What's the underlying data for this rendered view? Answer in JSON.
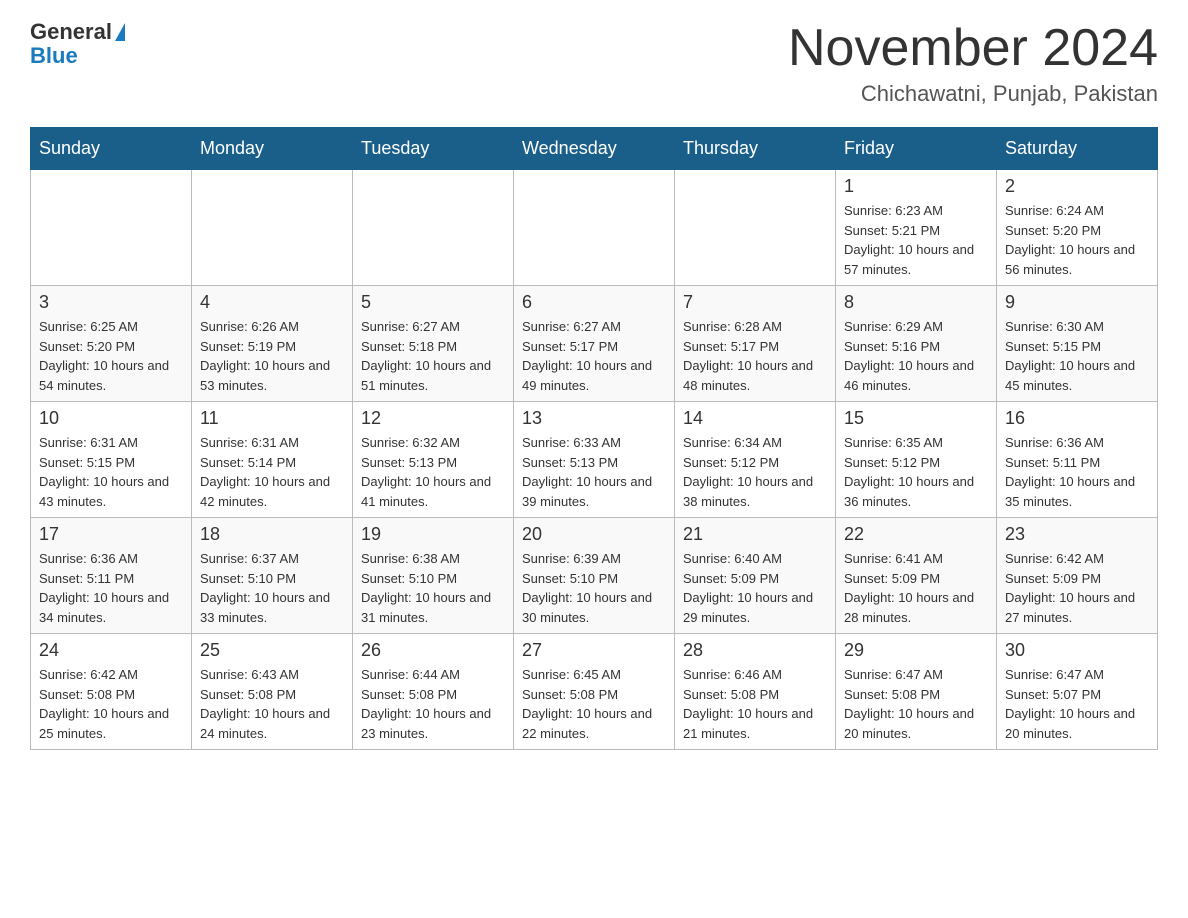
{
  "header": {
    "logo_general": "General",
    "logo_blue": "Blue",
    "month_title": "November 2024",
    "location": "Chichawatni, Punjab, Pakistan"
  },
  "weekdays": [
    "Sunday",
    "Monday",
    "Tuesday",
    "Wednesday",
    "Thursday",
    "Friday",
    "Saturday"
  ],
  "weeks": [
    [
      {
        "day": "",
        "sunrise": "",
        "sunset": "",
        "daylight": ""
      },
      {
        "day": "",
        "sunrise": "",
        "sunset": "",
        "daylight": ""
      },
      {
        "day": "",
        "sunrise": "",
        "sunset": "",
        "daylight": ""
      },
      {
        "day": "",
        "sunrise": "",
        "sunset": "",
        "daylight": ""
      },
      {
        "day": "",
        "sunrise": "",
        "sunset": "",
        "daylight": ""
      },
      {
        "day": "1",
        "sunrise": "Sunrise: 6:23 AM",
        "sunset": "Sunset: 5:21 PM",
        "daylight": "Daylight: 10 hours and 57 minutes."
      },
      {
        "day": "2",
        "sunrise": "Sunrise: 6:24 AM",
        "sunset": "Sunset: 5:20 PM",
        "daylight": "Daylight: 10 hours and 56 minutes."
      }
    ],
    [
      {
        "day": "3",
        "sunrise": "Sunrise: 6:25 AM",
        "sunset": "Sunset: 5:20 PM",
        "daylight": "Daylight: 10 hours and 54 minutes."
      },
      {
        "day": "4",
        "sunrise": "Sunrise: 6:26 AM",
        "sunset": "Sunset: 5:19 PM",
        "daylight": "Daylight: 10 hours and 53 minutes."
      },
      {
        "day": "5",
        "sunrise": "Sunrise: 6:27 AM",
        "sunset": "Sunset: 5:18 PM",
        "daylight": "Daylight: 10 hours and 51 minutes."
      },
      {
        "day": "6",
        "sunrise": "Sunrise: 6:27 AM",
        "sunset": "Sunset: 5:17 PM",
        "daylight": "Daylight: 10 hours and 49 minutes."
      },
      {
        "day": "7",
        "sunrise": "Sunrise: 6:28 AM",
        "sunset": "Sunset: 5:17 PM",
        "daylight": "Daylight: 10 hours and 48 minutes."
      },
      {
        "day": "8",
        "sunrise": "Sunrise: 6:29 AM",
        "sunset": "Sunset: 5:16 PM",
        "daylight": "Daylight: 10 hours and 46 minutes."
      },
      {
        "day": "9",
        "sunrise": "Sunrise: 6:30 AM",
        "sunset": "Sunset: 5:15 PM",
        "daylight": "Daylight: 10 hours and 45 minutes."
      }
    ],
    [
      {
        "day": "10",
        "sunrise": "Sunrise: 6:31 AM",
        "sunset": "Sunset: 5:15 PM",
        "daylight": "Daylight: 10 hours and 43 minutes."
      },
      {
        "day": "11",
        "sunrise": "Sunrise: 6:31 AM",
        "sunset": "Sunset: 5:14 PM",
        "daylight": "Daylight: 10 hours and 42 minutes."
      },
      {
        "day": "12",
        "sunrise": "Sunrise: 6:32 AM",
        "sunset": "Sunset: 5:13 PM",
        "daylight": "Daylight: 10 hours and 41 minutes."
      },
      {
        "day": "13",
        "sunrise": "Sunrise: 6:33 AM",
        "sunset": "Sunset: 5:13 PM",
        "daylight": "Daylight: 10 hours and 39 minutes."
      },
      {
        "day": "14",
        "sunrise": "Sunrise: 6:34 AM",
        "sunset": "Sunset: 5:12 PM",
        "daylight": "Daylight: 10 hours and 38 minutes."
      },
      {
        "day": "15",
        "sunrise": "Sunrise: 6:35 AM",
        "sunset": "Sunset: 5:12 PM",
        "daylight": "Daylight: 10 hours and 36 minutes."
      },
      {
        "day": "16",
        "sunrise": "Sunrise: 6:36 AM",
        "sunset": "Sunset: 5:11 PM",
        "daylight": "Daylight: 10 hours and 35 minutes."
      }
    ],
    [
      {
        "day": "17",
        "sunrise": "Sunrise: 6:36 AM",
        "sunset": "Sunset: 5:11 PM",
        "daylight": "Daylight: 10 hours and 34 minutes."
      },
      {
        "day": "18",
        "sunrise": "Sunrise: 6:37 AM",
        "sunset": "Sunset: 5:10 PM",
        "daylight": "Daylight: 10 hours and 33 minutes."
      },
      {
        "day": "19",
        "sunrise": "Sunrise: 6:38 AM",
        "sunset": "Sunset: 5:10 PM",
        "daylight": "Daylight: 10 hours and 31 minutes."
      },
      {
        "day": "20",
        "sunrise": "Sunrise: 6:39 AM",
        "sunset": "Sunset: 5:10 PM",
        "daylight": "Daylight: 10 hours and 30 minutes."
      },
      {
        "day": "21",
        "sunrise": "Sunrise: 6:40 AM",
        "sunset": "Sunset: 5:09 PM",
        "daylight": "Daylight: 10 hours and 29 minutes."
      },
      {
        "day": "22",
        "sunrise": "Sunrise: 6:41 AM",
        "sunset": "Sunset: 5:09 PM",
        "daylight": "Daylight: 10 hours and 28 minutes."
      },
      {
        "day": "23",
        "sunrise": "Sunrise: 6:42 AM",
        "sunset": "Sunset: 5:09 PM",
        "daylight": "Daylight: 10 hours and 27 minutes."
      }
    ],
    [
      {
        "day": "24",
        "sunrise": "Sunrise: 6:42 AM",
        "sunset": "Sunset: 5:08 PM",
        "daylight": "Daylight: 10 hours and 25 minutes."
      },
      {
        "day": "25",
        "sunrise": "Sunrise: 6:43 AM",
        "sunset": "Sunset: 5:08 PM",
        "daylight": "Daylight: 10 hours and 24 minutes."
      },
      {
        "day": "26",
        "sunrise": "Sunrise: 6:44 AM",
        "sunset": "Sunset: 5:08 PM",
        "daylight": "Daylight: 10 hours and 23 minutes."
      },
      {
        "day": "27",
        "sunrise": "Sunrise: 6:45 AM",
        "sunset": "Sunset: 5:08 PM",
        "daylight": "Daylight: 10 hours and 22 minutes."
      },
      {
        "day": "28",
        "sunrise": "Sunrise: 6:46 AM",
        "sunset": "Sunset: 5:08 PM",
        "daylight": "Daylight: 10 hours and 21 minutes."
      },
      {
        "day": "29",
        "sunrise": "Sunrise: 6:47 AM",
        "sunset": "Sunset: 5:08 PM",
        "daylight": "Daylight: 10 hours and 20 minutes."
      },
      {
        "day": "30",
        "sunrise": "Sunrise: 6:47 AM",
        "sunset": "Sunset: 5:07 PM",
        "daylight": "Daylight: 10 hours and 20 minutes."
      }
    ]
  ]
}
